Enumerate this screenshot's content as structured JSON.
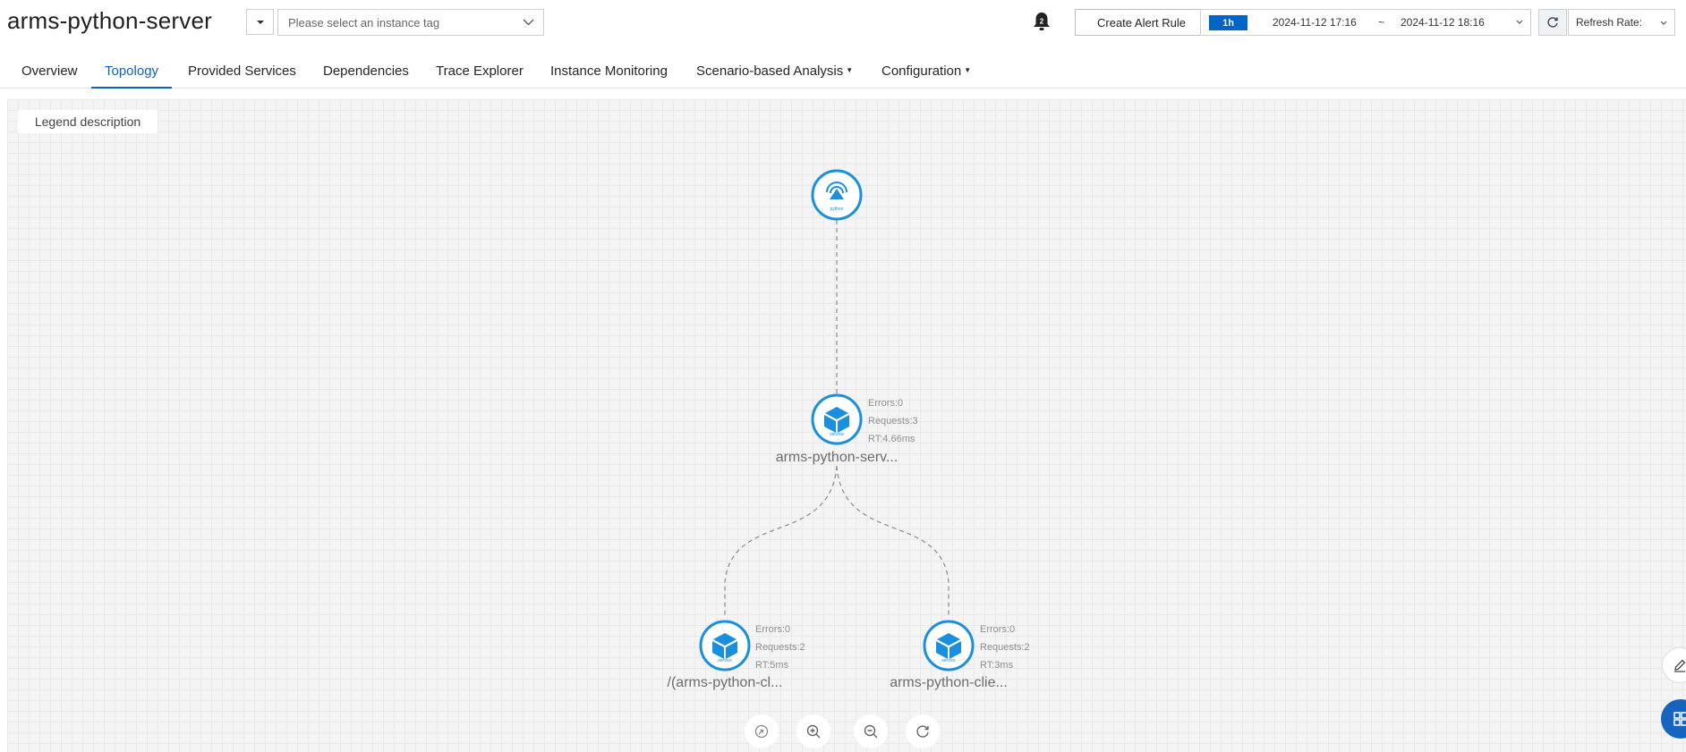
{
  "header": {
    "title": "arms-python-server",
    "tag_select_placeholder": "Please select an instance tag",
    "create_alert_label": "Create Alert Rule",
    "time_range": {
      "badge": "1h",
      "start": "2024-11-12 17:16",
      "separator": "~",
      "end": "2024-11-12 18:16"
    },
    "refresh_rate_label": "Refresh Rate:"
  },
  "tabs": [
    {
      "label": "Overview"
    },
    {
      "label": "Topology",
      "active": true
    },
    {
      "label": "Provided Services"
    },
    {
      "label": "Dependencies"
    },
    {
      "label": "Trace Explorer"
    },
    {
      "label": "Instance Monitoring"
    },
    {
      "label": "Scenario-based Analysis",
      "dropdown": true
    },
    {
      "label": "Configuration",
      "dropdown": true
    }
  ],
  "topology": {
    "legend_label": "Legend description",
    "nodes": [
      {
        "id": "python",
        "icon": "python-icon",
        "caption": "python"
      },
      {
        "id": "server",
        "icon": "cube-icon",
        "caption": "service",
        "label": "arms-python-serv...",
        "errors": "Errors:0",
        "requests": "Requests:3",
        "rt": "RT:4.66ms"
      },
      {
        "id": "client1",
        "icon": "cube-icon",
        "caption": "service",
        "label": "/(arms-python-cl...",
        "errors": "Errors:0",
        "requests": "Requests:2",
        "rt": "RT:5ms"
      },
      {
        "id": "client2",
        "icon": "cube-icon",
        "caption": "service",
        "label": "arms-python-clie...",
        "errors": "Errors:0",
        "requests": "Requests:2",
        "rt": "RT:3ms"
      }
    ],
    "controls": [
      "fit-view-icon",
      "zoom-in-icon",
      "zoom-out-icon",
      "reset-icon"
    ]
  },
  "colors": {
    "accent": "#0b62c4",
    "node_blue": "#1a8fe0",
    "badge_bg": "#0064c8"
  }
}
